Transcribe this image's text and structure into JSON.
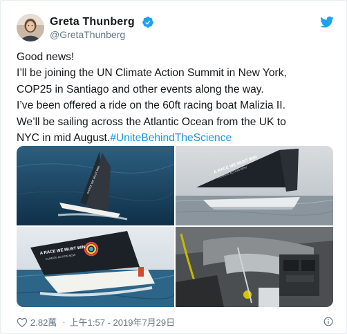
{
  "author": {
    "name": "Greta Thunberg",
    "handle": "@GretaThunberg",
    "verified": true
  },
  "tweet": {
    "lines": [
      "Good news!",
      "I’ll be joining the UN Climate Action Summit in New York,",
      "COP25 in Santiago and other events along the way.",
      "I’ve been offered a ride on the 60ft racing boat Malizia II.",
      "We’ll be sailing across the Atlantic Ocean from the UK to"
    ],
    "last_line_text": "NYC in mid August.",
    "hashtag": "#UniteBehindTheScience"
  },
  "media": {
    "photos": [
      {
        "description_icon": "sailboat-photo",
        "sail_text": "A RACE WE MUST WIN",
        "sail_subtext": "CLIMATE ACTION NOW"
      },
      {
        "description_icon": "sailboat-photo",
        "sail_text": "A RACE WE MUST WIN",
        "sail_subtext": "CLIMATE ACTION NOW"
      },
      {
        "description_icon": "sailboat-photo",
        "sail_text": "A RACE WE MUST WIN",
        "sail_subtext": "CLIMATE ACTION NOW"
      },
      {
        "description_icon": "cabin-interior-photo"
      }
    ]
  },
  "footer": {
    "likes": "2.82萬",
    "dot": "·",
    "timestamp": "上午1:57 - 2019年7月29日"
  },
  "colors": {
    "link": "#1b95e0",
    "verified": "#1da1f2",
    "muted": "#657786"
  }
}
